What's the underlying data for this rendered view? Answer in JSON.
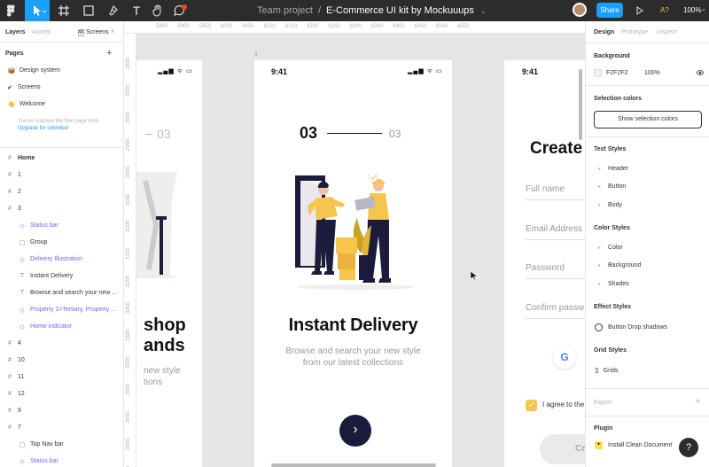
{
  "toolbar": {
    "breadcrumb_project": "Team project",
    "breadcrumb_sep": "/",
    "file_name": "E-Commerce UI kit by Mockuuups",
    "share_label": "Share",
    "zoom": "100%",
    "play_icon": "play-icon",
    "font_label": "A?"
  },
  "left_panel": {
    "tabs": {
      "layers": "Layers",
      "assets": "Assets",
      "screens": "Screens"
    },
    "pages_title": "Pages",
    "add_icon": "+",
    "pages": [
      {
        "icon": "📦",
        "label": "Design system"
      },
      {
        "icon": "✔",
        "label": "Screens"
      },
      {
        "icon": "👋",
        "label": "Welcome"
      }
    ],
    "free_limit_note": "You've reached the free page limit.",
    "upgrade_link": "Upgrade for unlimited",
    "layers": [
      {
        "icon": "#",
        "label": "Home",
        "indent": 0,
        "purple": false,
        "bold": true
      },
      {
        "icon": "#",
        "label": "1",
        "indent": 0,
        "purple": false,
        "bold": false
      },
      {
        "icon": "#",
        "label": "2",
        "indent": 0,
        "purple": false,
        "bold": false
      },
      {
        "icon": "#",
        "label": "3",
        "indent": 0,
        "purple": false,
        "bold": false
      },
      {
        "icon": "◇",
        "label": "Status bar",
        "indent": 1,
        "purple": true,
        "bold": false
      },
      {
        "icon": "▢",
        "label": "Group",
        "indent": 1,
        "purple": false,
        "bold": false
      },
      {
        "icon": "◇",
        "label": "Delivery Illustration",
        "indent": 1,
        "purple": true,
        "bold": false
      },
      {
        "icon": "T",
        "label": "Instant Delivery",
        "indent": 1,
        "purple": false,
        "bold": false
      },
      {
        "icon": "T",
        "label": "Browse and search your new ...",
        "indent": 1,
        "purple": false,
        "bold": false
      },
      {
        "icon": "◇",
        "label": "Property 1=Tertiary, Property ...",
        "indent": 1,
        "purple": true,
        "bold": false
      },
      {
        "icon": "◇",
        "label": "Home indicator",
        "indent": 1,
        "purple": true,
        "bold": false
      },
      {
        "icon": "#",
        "label": "4",
        "indent": 0,
        "purple": false,
        "bold": false
      },
      {
        "icon": "#",
        "label": "10",
        "indent": 0,
        "purple": false,
        "bold": false
      },
      {
        "icon": "#",
        "label": "11",
        "indent": 0,
        "purple": false,
        "bold": false
      },
      {
        "icon": "#",
        "label": "12",
        "indent": 0,
        "purple": false,
        "bold": false
      },
      {
        "icon": "#",
        "label": "9",
        "indent": 0,
        "purple": false,
        "bold": false
      },
      {
        "icon": "#",
        "label": "7",
        "indent": 0,
        "purple": false,
        "bold": false
      },
      {
        "icon": "▢",
        "label": "Top Nav bar",
        "indent": 1,
        "purple": false,
        "bold": false
      },
      {
        "icon": "◇",
        "label": "Status bar",
        "indent": 1,
        "purple": true,
        "bold": false
      }
    ]
  },
  "rulers": {
    "top": [
      "5850",
      "5900",
      "5950",
      "6000",
      "6050",
      "6100",
      "6150",
      "6200",
      "6250",
      "6300",
      "6350",
      "6400",
      "6450",
      "6500",
      "6550"
    ],
    "left": [
      "2800",
      "2850",
      "2900",
      "2950",
      "3000",
      "3050",
      "3100",
      "3150",
      "3200",
      "3250",
      "3300",
      "3350",
      "3400",
      "3450",
      "3500",
      "3550"
    ]
  },
  "canvas": {
    "frame_label": "3",
    "left_frame": {
      "page_num": "03",
      "heading_line1": "shop",
      "heading_line2": "ands",
      "body_line1": "new style",
      "body_line2": "tions"
    },
    "center_frame": {
      "time": "9:41",
      "page_current": "03",
      "page_total": "03",
      "title": "Instant Delivery",
      "subtitle_line1": "Browse and search your new style",
      "subtitle_line2": "from our latest collections",
      "next_icon": "›"
    },
    "right_frame": {
      "time": "9:41",
      "heading": "Create",
      "fields": [
        "Full name",
        "Email Address",
        "Password",
        "Confirm passw"
      ],
      "google_g": "G",
      "agree_text": "I agree to the",
      "button_partial": "Cr"
    },
    "colors": {
      "navy": "#1b1c3b",
      "yellow": "#f6c54b",
      "bg": "#e5e5e5"
    }
  },
  "right_panel": {
    "tabs": {
      "design": "Design",
      "prototype": "Prototype",
      "inspect": "Inspect"
    },
    "background_title": "Background",
    "background_hex": "F2F2F2",
    "background_opacity": "100%",
    "selection_colors_title": "Selection colors",
    "show_selection_colors": "Show selection colors",
    "text_styles_title": "Text Styles",
    "text_styles": [
      "Header",
      "Button",
      "Body"
    ],
    "color_styles_title": "Color Styles",
    "color_styles": [
      "Color",
      "Background",
      "Shades"
    ],
    "effect_styles_title": "Effect Styles",
    "effect_styles": [
      "Button Drop shadows"
    ],
    "grid_styles_title": "Grid Styles",
    "grid_styles": [
      "Grids"
    ],
    "export_title": "Export",
    "plugin_title": "Plugin",
    "plugin_item": "Install Clean Document",
    "help": "?"
  }
}
